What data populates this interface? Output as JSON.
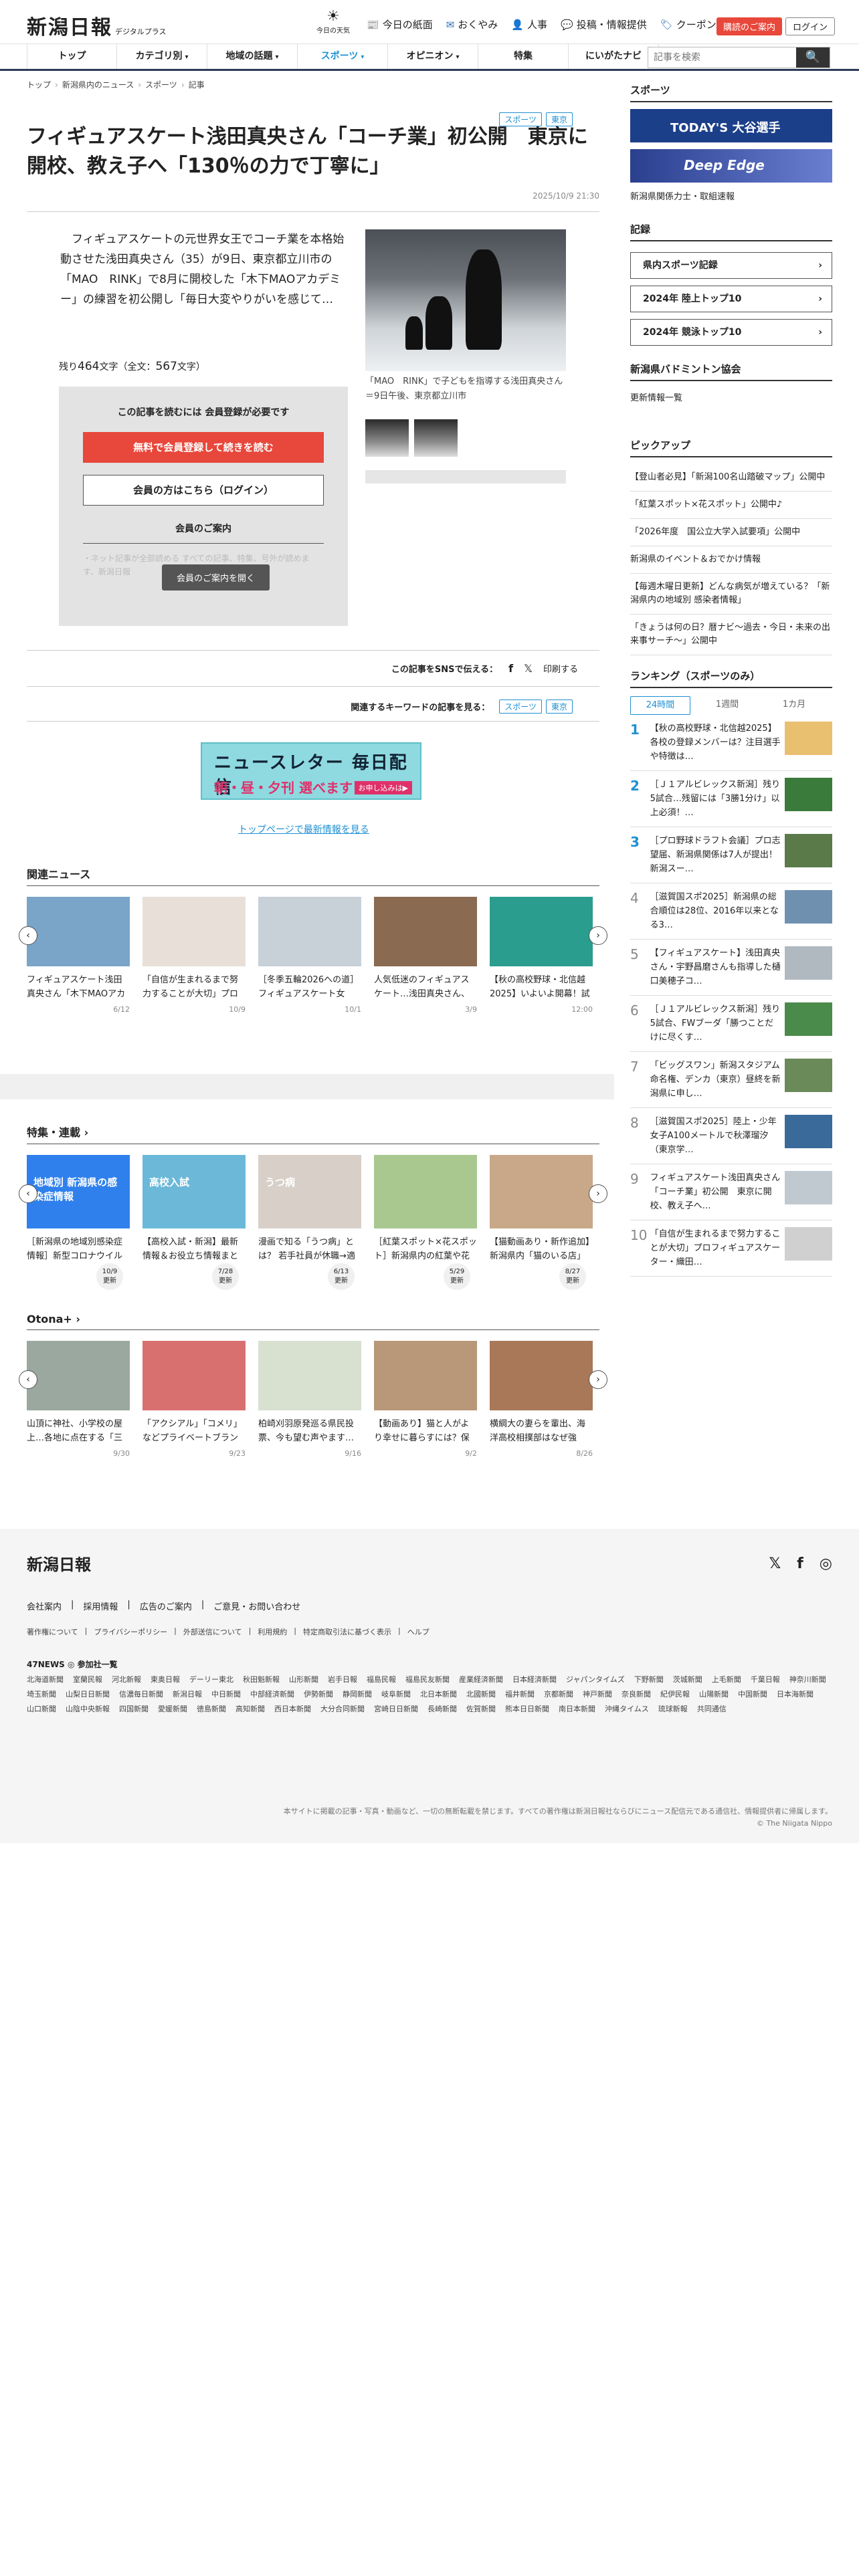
{
  "header": {
    "logo": "新潟日報",
    "logo_sub": "デジタルプラス",
    "today_label": "今日の天気",
    "links": [
      {
        "icon": "📰",
        "label": "今日の紙面"
      },
      {
        "icon": "✉",
        "label": "おくやみ"
      },
      {
        "icon": "👤",
        "label": "人事"
      },
      {
        "icon": "💬",
        "label": "投稿・情報提供"
      },
      {
        "icon": "🏷",
        "label": "クーポン"
      }
    ],
    "store_btn": "購読のご案内",
    "login_btn": "ログイン"
  },
  "nav": {
    "items": [
      {
        "label": "トップ",
        "caret": ""
      },
      {
        "label": "カテゴリ別",
        "caret": "▾"
      },
      {
        "label": "地域の話題",
        "caret": "▾"
      },
      {
        "label": "スポーツ",
        "caret": "▾"
      },
      {
        "label": "オピニオン",
        "caret": "▾"
      },
      {
        "label": "特集",
        "caret": ""
      },
      {
        "label": "にいがたナビ",
        "caret": ""
      }
    ],
    "search_placeholder": "記事を検索",
    "search_icon": "🔍"
  },
  "breadcrumb": [
    "トップ",
    "新潟県内のニュース",
    "スポーツ",
    "記事"
  ],
  "article": {
    "tags": [
      "スポーツ",
      "東京"
    ],
    "title": "フィギュアスケート浅田真央さん「コーチ業」初公開　東京に開校、教え子へ「130％の力で丁寧に」",
    "date": "2025/10/9 21:30",
    "lead": "　フィギュアスケートの元世界女王でコーチ業を本格始動させた浅田真央さん（35）が9日、東京都立川市の「MAO　RINK」で8月に開校した「木下MAOアカデミー」の練習を初公開し「毎日大変やりがいを感じて…",
    "chars_a": "残り",
    "chars_n1": "464",
    "chars_b": "文字（全文：",
    "chars_n2": "567",
    "chars_c": "文字）",
    "caption": "「MAO　RINK」で子どもを指導する浅田真央さん＝9日午後、東京都立川市"
  },
  "paywall": {
    "title": "この記事を読むには 会員登録が必要です",
    "register": "無料で会員登録して続きを読む",
    "login": "会員の方はこちら（ログイン）",
    "guide": "会員のご案内",
    "faded": "・ネット記事が全部読める\nすべての記事、特集、号外が読めます、新潟日報",
    "guide_btn": "会員のご案内を開く"
  },
  "share": {
    "label": "この記事をSNSで伝える：",
    "fb": "f",
    "x": "𝕏",
    "print": "印刷する"
  },
  "keywords": {
    "label": "関連するキーワードの記事を見る：",
    "items": [
      "スポーツ",
      "東京"
    ]
  },
  "newsletter": {
    "l1": "ニュースレター 毎日配信",
    "l2": "朝・昼・夕刊 選べます",
    "l3": "お申し込みは▶"
  },
  "toplink": "トップページで最新情報を見る",
  "related": {
    "heading": "関連ニュース",
    "items": [
      {
        "text": "フィギュアスケート浅田真央さん「木下MAOアカデミー」設立、…",
        "date": "6/12",
        "color": "#7aa4c8"
      },
      {
        "text": "「自信が生まれるまで努力することが大切」プロフィギュアスケー…",
        "date": "10/9",
        "color": "#e8e0d8"
      },
      {
        "text": "［冬季五輪2026への道］フィギュアスケート女子・中井亜美（…",
        "date": "10/1",
        "color": "#c8d0d8"
      },
      {
        "text": "人気低迷のフィギュアスケート…浅田真央さん、羽生結弦さん、高…",
        "date": "3/9",
        "color": "#8a6a50"
      },
      {
        "text": "【秋の高校野球・北信越2025】いよいよ開幕！試合当日は試合…",
        "date": "12:00",
        "color": "#2a9d8f"
      }
    ]
  },
  "features": {
    "heading": "特集・連載",
    "items": [
      {
        "text": "［新潟県の地域別感染症情報］新型コロナウイルスが増加傾向に　…",
        "date": "10/9",
        "color": "#2f80ed",
        "label": "地域別 新潟県の感染症情報"
      },
      {
        "text": "【高校入試・新潟】最新情報＆お役立ち情報まとめ　倍率・過去問も",
        "date": "7/28",
        "color": "#6bb8d8",
        "label": "高校入試"
      },
      {
        "text": "漫画で知る「うつ病」とは？ 若手社員が休職→適応→復職する ま…",
        "date": "6/13",
        "color": "#d8d0c8",
        "label": "うつ病"
      },
      {
        "text": "［紅葉スポット×花スポット］新潟県内の紅葉や花畑、映える名所…",
        "date": "5/29",
        "color": "#a8c890",
        "label": ""
      },
      {
        "text": "【猫動画あり・新作追加】新潟県内「猫のいる店」でモフモフに触…",
        "date": "8/27",
        "color": "#c8a888",
        "label": ""
      }
    ],
    "badge": "更新"
  },
  "otona": {
    "heading": "Otona+",
    "items": [
      {
        "text": "山頂に神社、小学校の屋上…各地に点在する「三角点」って？形は…",
        "date": "9/30",
        "color": "#9aa8a0"
      },
      {
        "text": "「アクシアル」「コメリ」などプライベートブランド開発の裏側お…",
        "date": "9/23",
        "color": "#d87070"
      },
      {
        "text": "柏崎刈羽原発巡る県民投票、今も望む声やます…首長らとの「意思…",
        "date": "9/16",
        "color": "#d8e0d0"
      },
      {
        "text": "【動画あり】猫と人がより幸せに暮らすには？保護猫と新たな飼い…",
        "date": "9/2",
        "color": "#b89878"
      },
      {
        "text": "横綱大の妻らを輩出、海洋高校相撲部はなぜ強い？厳しい基礎練習…",
        "date": "8/26",
        "color": "#a87858"
      }
    ]
  },
  "sidebar": {
    "sports_heading": "スポーツ",
    "banner1": "TODAY'S 大谷選手",
    "banner2": "Deep Edge",
    "sports_link": "新潟県関係力士・取組速報",
    "records_heading": "記録",
    "records": [
      "県内スポーツ記録",
      "2024年 陸上トップ10",
      "2024年 競泳トップ10"
    ],
    "badminton_heading": "新潟県バドミントン協会",
    "badminton_link": "更新情報一覧",
    "pickup_heading": "ピックアップ",
    "pickup": [
      "【登山者必見】「新潟100名山踏破マップ」公開中",
      "「紅葉スポット×花スポット」公開中♪",
      "「2026年度　国公立大学入試要項」公開中",
      "新潟県のイベント＆おでかけ情報",
      "【毎週木曜日更新】どんな病気が増えている？「新潟県内の地域別 感染者情報」",
      "「きょうは何の日？暦ナビ～過去・今日・未来の出来事サーチ～」公開中"
    ],
    "ranking_heading": "ランキング（スポーツのみ）",
    "ranking_tabs": [
      "24時間",
      "1週間",
      "1カ月"
    ],
    "ranking": [
      {
        "n": "1",
        "text": "【秋の高校野球・北信越2025】各校の登録メンバーは？注目選手や特徴は…",
        "color": "#e8c070"
      },
      {
        "n": "2",
        "text": "［Ｊ１アルビレックス新潟］残り5試合…残留には「3勝1分け」以上必須！…",
        "color": "#3a7a3a"
      },
      {
        "n": "3",
        "text": "［プロ野球ドラフト会議］プロ志望届、新潟県関係は7人が提出！新潟スー…",
        "color": "#5a7a4a"
      },
      {
        "n": "4",
        "text": "［滋賀国スポ2025］新潟県の総合順位は28位、2016年以来となる3…",
        "color": "#7090b0"
      },
      {
        "n": "5",
        "text": "【フィギュアスケート】浅田真央さん・宇野昌磨さんも指導した樋口美穂子コ…",
        "color": "#b0b8c0"
      },
      {
        "n": "6",
        "text": "［Ｊ１アルビレックス新潟］残り5試合、FWブーダ「勝つことだけに尽くす…",
        "color": "#4a8a4a"
      },
      {
        "n": "7",
        "text": "「ビッグスワン」新潟スタジアム命名権、デンカ（東京）昼終を新潟県に申し…",
        "color": "#6a8a5a"
      },
      {
        "n": "8",
        "text": "［滋賀国スポ2025］陸上・少年女子A100メートルで秋澤瑠汐（東京学…",
        "color": "#3a6a9a"
      },
      {
        "n": "9",
        "text": "フィギュアスケート浅田真央さん「コーチ業」初公開　東京に開校、教え子へ…",
        "color": "#c0c8d0"
      },
      {
        "n": "10",
        "text": "「自信が生まれるまで努力することが大切」プロフィギュアスケーター・織田…",
        "color": "#d0d0d0"
      }
    ]
  },
  "footer": {
    "logo": "新潟日報",
    "social": [
      "𝕏",
      "f",
      "◎"
    ],
    "links1": [
      "会社案内",
      "採用情報",
      "広告のご案内",
      "ご意見・お問い合わせ"
    ],
    "links2": [
      "著作権について",
      "プライバシーポリシー",
      "外部送信について",
      "利用規約",
      "特定商取引法に基づく表示",
      "ヘルプ"
    ],
    "news47": "47NEWS ◎ 参加社一覧",
    "papers": [
      "北海道新聞",
      "室蘭民報",
      "河北新報",
      "東奥日報",
      "デーリー東北",
      "秋田魁新報",
      "山形新聞",
      "岩手日報",
      "福島民報",
      "福島民友新聞",
      "産業経済新聞",
      "日本経済新聞",
      "ジャパンタイムズ",
      "下野新聞",
      "茨城新聞",
      "上毛新聞",
      "千葉日報",
      "神奈川新聞",
      "埼玉新聞",
      "山梨日日新聞",
      "信濃毎日新聞",
      "新潟日報",
      "中日新聞",
      "中部経済新聞",
      "伊勢新聞",
      "静岡新聞",
      "岐阜新聞",
      "北日本新聞",
      "北國新聞",
      "福井新聞",
      "京都新聞",
      "神戸新聞",
      "奈良新聞",
      "紀伊民報",
      "山陽新聞",
      "中国新聞",
      "日本海新聞",
      "山口新聞",
      "山陰中央新報",
      "四国新聞",
      "愛媛新聞",
      "徳島新聞",
      "高知新聞",
      "西日本新聞",
      "大分合同新聞",
      "宮崎日日新聞",
      "長崎新聞",
      "佐賀新聞",
      "熊本日日新聞",
      "南日本新聞",
      "沖縄タイムス",
      "琉球新報",
      "共同通信"
    ],
    "copy1": "本サイトに掲載の記事・写真・動画など、一切の無断転載を禁じます。すべての著作権は新潟日報社ならびにニュース配信元である通信社、情報提供者に帰属します。",
    "copy2": "© The Niigata Nippo"
  }
}
